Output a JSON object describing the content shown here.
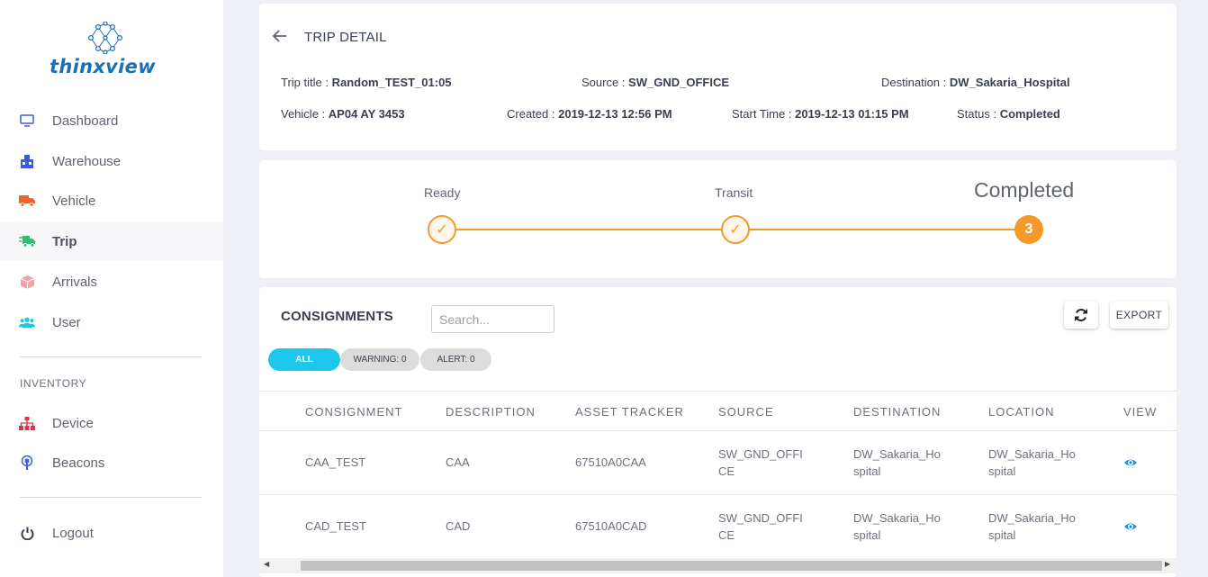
{
  "brand": {
    "name": "thinxview",
    "color": "#1a6fb5"
  },
  "sidebar": {
    "items": [
      {
        "label": "Dashboard",
        "icon": "monitor-icon",
        "color": "#3b5bdb"
      },
      {
        "label": "Warehouse",
        "icon": "warehouse-icon",
        "color": "#3b5bdb"
      },
      {
        "label": "Vehicle",
        "icon": "truck-icon",
        "color": "#f0642b"
      },
      {
        "label": "Trip",
        "icon": "trip-truck-icon",
        "color": "#2fbf71",
        "active": true
      },
      {
        "label": "Arrivals",
        "icon": "box-icon",
        "color": "#f3a0a8"
      },
      {
        "label": "User",
        "icon": "users-icon",
        "color": "#1ec8ec"
      }
    ],
    "inventory_label": "INVENTORY",
    "inventory_items": [
      {
        "label": "Device",
        "icon": "sitemap-icon",
        "color": "#e0334a"
      },
      {
        "label": "Beacons",
        "icon": "beacon-icon",
        "color": "#3b5bdb"
      }
    ],
    "logout_label": "Logout"
  },
  "trip_detail": {
    "title": "TRIP DETAIL",
    "trip_title_label": "Trip title :",
    "trip_title": "Random_TEST_01:05",
    "source_label": "Source :",
    "source": "SW_GND_OFFICE",
    "destination_label": "Destination :",
    "destination": "DW_Sakaria_Hospital",
    "vehicle_label": "Vehicle :",
    "vehicle": "AP04 AY 3453",
    "created_label": "Created :",
    "created": "2019-12-13 12:56 PM",
    "start_time_label": "Start Time :",
    "start_time": "2019-12-13 01:15 PM",
    "status_label": "Status :",
    "status": "Completed"
  },
  "progress": {
    "accent": "#f39a2b",
    "steps": [
      {
        "label": "Ready",
        "mark": "✓"
      },
      {
        "label": "Transit",
        "mark": "✓"
      },
      {
        "label": "Completed",
        "mark": "3"
      }
    ]
  },
  "consignments": {
    "title": "CONSIGNMENTS",
    "search_placeholder": "Search...",
    "export_label": "EXPORT",
    "filters": {
      "all": "ALL",
      "warning": "WARNING: 0",
      "alert": "ALERT: 0"
    },
    "columns": [
      "CONSIGNMENT",
      "DESCRIPTION",
      "ASSET TRACKER",
      "SOURCE",
      "DESTINATION",
      "LOCATION",
      "VIEW"
    ],
    "rows": [
      {
        "consignment": "CAA_TEST",
        "description": "CAA",
        "asset_tracker": "67510A0CAA",
        "source": "SW_GND_OFFICE",
        "destination": "DW_Sakaria_Hospital",
        "location": "DW_Sakaria_Hospital"
      },
      {
        "consignment": "CAD_TEST",
        "description": "CAD",
        "asset_tracker": "67510A0CAD",
        "source": "SW_GND_OFFICE",
        "destination": "DW_Sakaria_Hospital",
        "location": "DW_Sakaria_Hospital"
      }
    ]
  }
}
